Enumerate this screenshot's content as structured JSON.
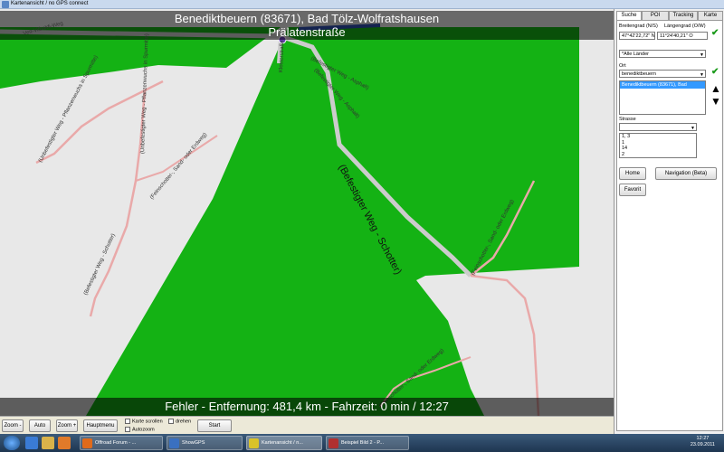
{
  "window": {
    "title": "Kartenansicht / no GPS connect"
  },
  "map": {
    "header_line1": "Benediktbeuern (83671), Bad Tölz-Wolfratshausen",
    "header_line2": "Prälatenstraße",
    "footer": "Fehler - Entfernung: 481,4 km - Fahrzeit: 0 min / 12:27",
    "colors": {
      "forest": "#14b214",
      "background": "#e8e8e8",
      "track": "#e9a9a9",
      "paved": "#cccccc"
    },
    "labels": {
      "veit": "Veit-Vilbaldi-Weg",
      "l1": "(Befestigter Weg - Asphalt)",
      "l2": "(Befestigter Weg - Asphalt)",
      "l3": "(Unbefestigter Weg - Pflanzenwuchs in Spurmitte)",
      "l4": "(Unbefestigter Weg - Pflanzenwuchs in Spurmitte)",
      "l5": "(Feinschotter-, Sand- oder Erdweg)",
      "l6": "(Befestigter Weg - Schotter)",
      "l7": "(Befestigter Weg - Schotter)",
      "l8": "(Feinschotter-, Sand- oder Erdweg)",
      "l9": "(Feinschotter-, Sand- oder Erdweg)",
      "l10": "Klosterstraße"
    }
  },
  "toolbar": {
    "zoom_minus": "Zoom -",
    "auto": "Auto",
    "zoom_plus": "Zoom +",
    "hauptmenu": "Hauptmenu",
    "karte_scrollen": "Karte scrollen",
    "autozoom": "Autozoom",
    "drehen": "drehen",
    "start": "Start"
  },
  "panel": {
    "tabs": [
      "Suche",
      "POI",
      "Tracking",
      "Karte"
    ],
    "lat_label": "Breitengrad (N/S)",
    "lon_label": "Längengrad (O/W)",
    "lat_value": "47°42'22,72\" N",
    "lon_value": "11°24'40,21\" O",
    "country": "*Alle Länder",
    "ort_label": "Ort",
    "ort_value": "benediktbeuern",
    "ort_result": "Benediktbeuern (83671), Bad",
    "strasse_label": "Strasse",
    "strasse_rows": [
      "1, 3",
      "1",
      "14",
      "2"
    ],
    "home": "Home",
    "navigation": "Navigation (Beta)",
    "favorit": "Favorit"
  },
  "taskbar": {
    "tasks": [
      "Offroad Forum - ...",
      "ShowGPS",
      "Kartenansicht / n...",
      "Beispiel Bild 2 - P..."
    ],
    "time": "12:27",
    "date": "23.09.2011"
  }
}
